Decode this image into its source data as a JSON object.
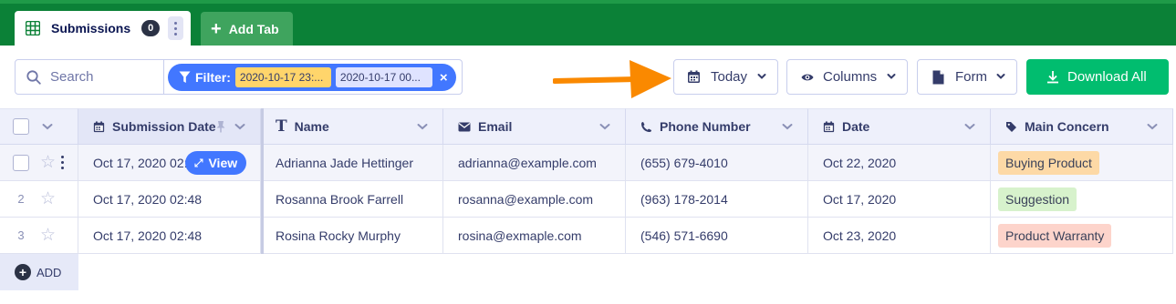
{
  "tabs": {
    "active_label": "Submissions",
    "active_count": "0",
    "add_tab_label": "Add Tab"
  },
  "toolbar": {
    "search_placeholder": "Search",
    "filter_label": "Filter:",
    "filter_chip_1": "2020-10-17 23:...",
    "filter_chip_2": "2020-10-17 00...",
    "filter_close": "×",
    "today_label": "Today",
    "columns_label": "Columns",
    "form_label": "Form",
    "download_label": "Download All"
  },
  "columns": [
    {
      "label": "Submission Date",
      "icon": "calendar-icon"
    },
    {
      "label": "Name",
      "icon": "text-icon"
    },
    {
      "label": "Email",
      "icon": "envelope-icon"
    },
    {
      "label": "Phone Number",
      "icon": "phone-icon"
    },
    {
      "label": "Date",
      "icon": "calendar-icon"
    },
    {
      "label": "Main Concern",
      "icon": "tag-icon"
    }
  ],
  "rows": [
    {
      "num": "",
      "submission_date": "Oct 17, 2020 02:",
      "name": "Adrianna Jade Hettinger",
      "email": "adrianna@example.com",
      "phone": "(655) 679-4010",
      "date": "Oct 22, 2020",
      "concern": "Buying Product",
      "concern_color": "#fdd9a6"
    },
    {
      "num": "2",
      "submission_date": "Oct 17, 2020 02:48",
      "name": "Rosanna Brook Farrell",
      "email": "rosanna@example.com",
      "phone": "(963) 178-2014",
      "date": "Oct 17, 2020",
      "concern": "Suggestion",
      "concern_color": "#d7f2cc"
    },
    {
      "num": "3",
      "submission_date": "Oct 17, 2020 02:48",
      "name": "Rosina Rocky Murphy",
      "email": "rosina@exmaple.com",
      "phone": "(546) 571-6690",
      "date": "Oct 23, 2020",
      "concern": "Product Warranty",
      "concern_color": "#fdd4cb"
    }
  ],
  "row_view_label": "View",
  "add_row_label": "ADD",
  "colors": {
    "brand_green": "#0b8137",
    "accent_blue": "#4277ff",
    "download_green": "#01bd6f",
    "arrow_orange": "#fa8900"
  }
}
